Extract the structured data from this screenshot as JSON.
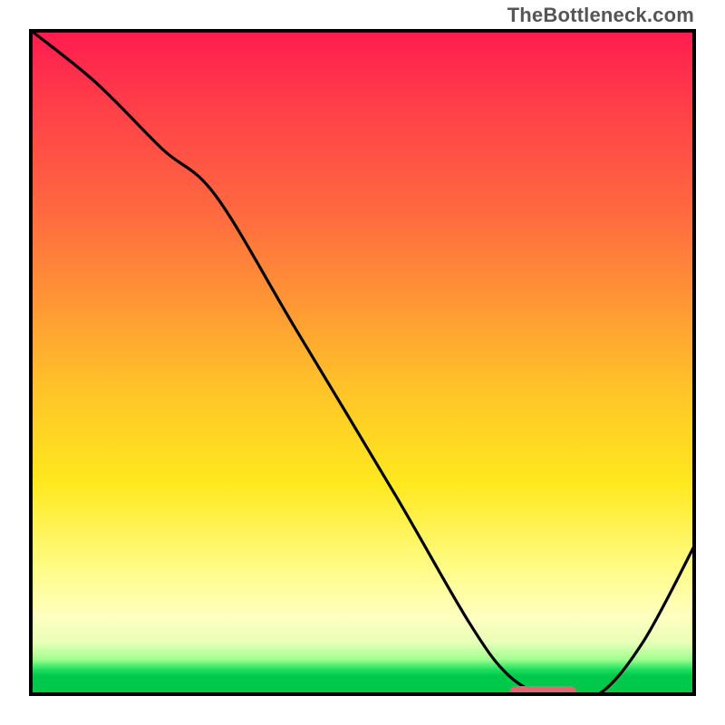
{
  "watermark": "TheBottleneck.com",
  "colors": {
    "frame": "#000000",
    "curve": "#000000",
    "marker": "#db6b70",
    "gradient_top": "#ff1a4f",
    "gradient_mid": "#ffe81e",
    "gradient_bottom": "#00c84a"
  },
  "chart_data": {
    "type": "line",
    "title": "",
    "xlabel": "",
    "ylabel": "",
    "xlim": [
      0,
      100
    ],
    "ylim": [
      0,
      100
    ],
    "series": [
      {
        "name": "bottleneck-curve",
        "x": [
          0,
          10,
          20,
          28,
          40,
          55,
          66,
          72,
          78,
          85,
          92,
          100
        ],
        "values": [
          100,
          92,
          82,
          75,
          55,
          30,
          11,
          3,
          0,
          0,
          8,
          23
        ]
      }
    ],
    "annotations": [
      {
        "name": "optimal-range-marker",
        "x_start": 72,
        "x_end": 82,
        "y": 0,
        "color": "#db6b70"
      }
    ]
  }
}
